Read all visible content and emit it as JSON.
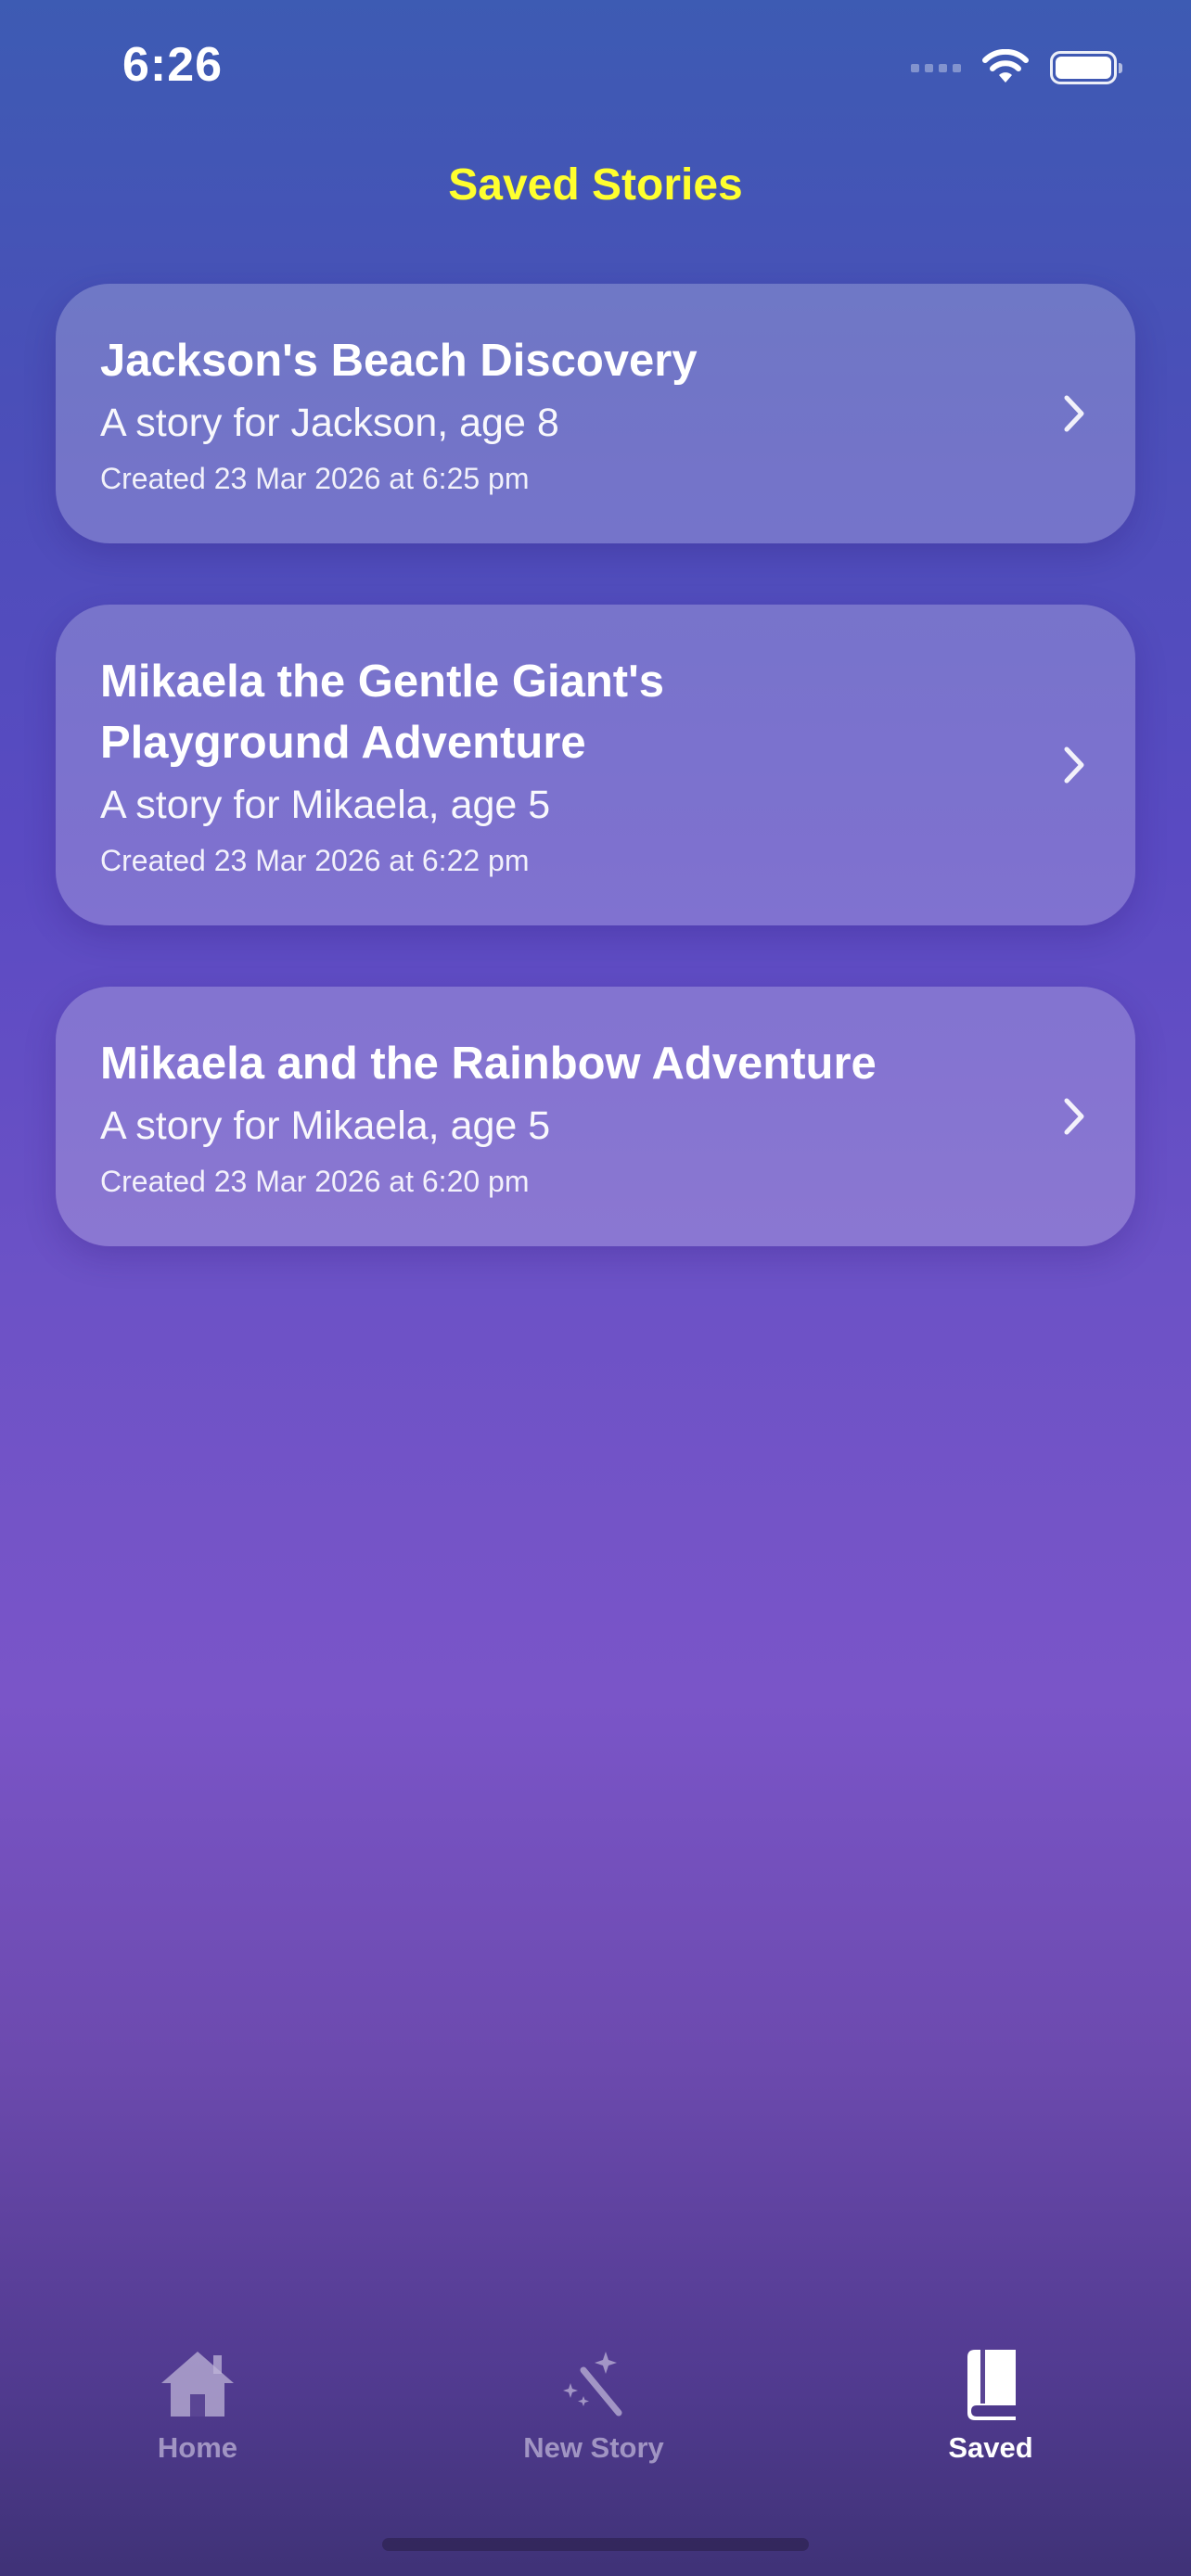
{
  "status_bar": {
    "time": "6:26",
    "wifi_icon": "wifi-icon",
    "battery_icon": "battery-icon",
    "signal_icon": "cellular-signal-icon"
  },
  "header": {
    "title": "Saved Stories",
    "title_color": "#ffff2e"
  },
  "stories": [
    {
      "title": "Jackson's Beach Discovery",
      "subtitle": "A story for Jackson, age 8",
      "created": "Created 23 Mar 2026 at 6:25 pm"
    },
    {
      "title": "Mikaela the Gentle Giant's Playground Adventure",
      "subtitle": "A story for Mikaela, age 5",
      "created": "Created 23 Mar 2026 at 6:22 pm"
    },
    {
      "title": "Mikaela and the Rainbow Adventure",
      "subtitle": "A story for Mikaela, age 5",
      "created": "Created 23 Mar 2026 at 6:20 pm"
    }
  ],
  "tab_bar": {
    "tabs": [
      {
        "label": "Home",
        "icon": "house-icon",
        "active": false
      },
      {
        "label": "New Story",
        "icon": "magic-wand-icon",
        "active": false
      },
      {
        "label": "Saved",
        "icon": "book-icon",
        "active": true
      }
    ]
  }
}
